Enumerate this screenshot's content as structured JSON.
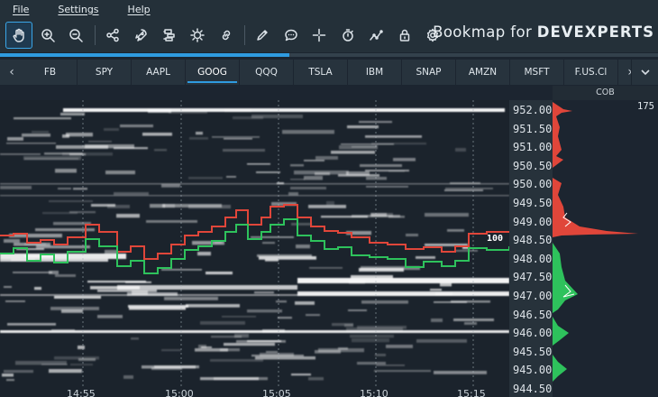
{
  "menu": [
    {
      "label": "File"
    },
    {
      "label": "Settings"
    },
    {
      "label": "Help"
    }
  ],
  "toolbar": {
    "tools": [
      {
        "icon": "hand-icon",
        "active": true
      },
      {
        "icon": "zoom-in-icon"
      },
      {
        "icon": "zoom-out-icon"
      },
      {
        "icon": "share-icon"
      },
      {
        "icon": "rocket-icon"
      },
      {
        "icon": "layers-icon"
      },
      {
        "icon": "brightness-icon"
      },
      {
        "icon": "link-icon"
      },
      {
        "icon": "pencil-icon"
      },
      {
        "icon": "chat-icon"
      },
      {
        "icon": "crosshair-icon"
      },
      {
        "icon": "timer-icon"
      },
      {
        "icon": "line-tool-icon"
      },
      {
        "icon": "lock-icon"
      },
      {
        "icon": "gear-icon"
      }
    ],
    "brand": "Bookmap for ",
    "brand_bold": "DEVEXPERTS"
  },
  "progress": {
    "fraction": 0.44,
    "color": "#2f9be0"
  },
  "tabs": {
    "items": [
      "FB",
      "SPY",
      "AAPL",
      "GOOG",
      "QQQ",
      "TSLA",
      "IBM",
      "SNAP",
      "AMZN",
      "MSFT",
      "F.US.Cl"
    ],
    "active_index": 3
  },
  "cob": {
    "title": "COB",
    "count": "175"
  },
  "price_axis": {
    "labels": [
      "952.00",
      "951.50",
      "951.00",
      "950.50",
      "950.00",
      "949.50",
      "949.00",
      "948.50",
      "948.00",
      "947.50",
      "947.00",
      "946.50",
      "946.00",
      "945.50",
      "945.00",
      "944.50"
    ]
  },
  "last_price_label": "100",
  "time_axis": {
    "labels": [
      "14:55",
      "15:00",
      "15:05",
      "15:10",
      "15:15"
    ]
  },
  "colors": {
    "ask": "#e0463a",
    "bid": "#2ec25c",
    "accent": "#2f9be0",
    "background": "#1b232c"
  }
}
